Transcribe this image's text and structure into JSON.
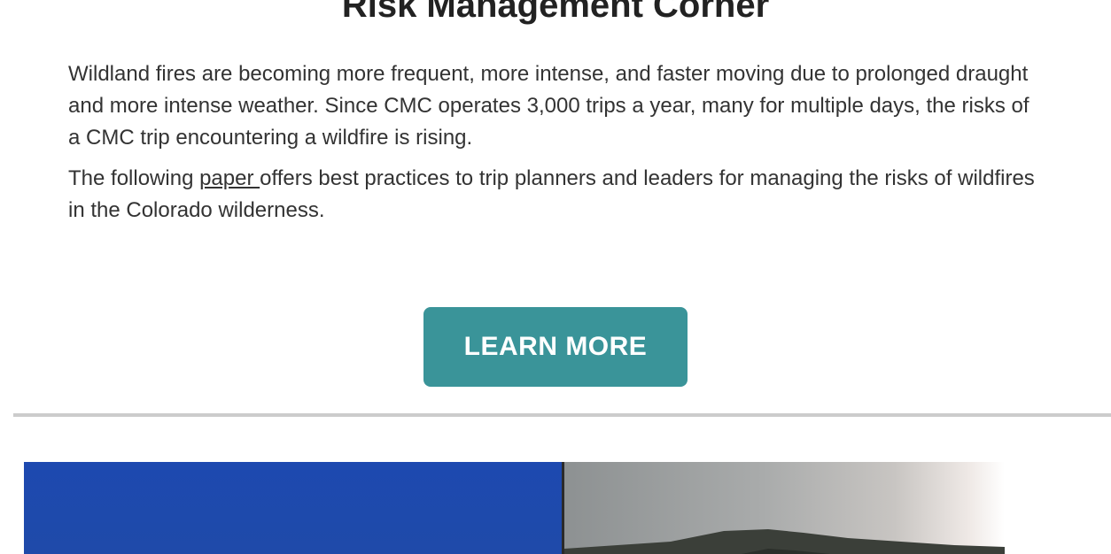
{
  "header": {
    "title": "Risk Management Corner"
  },
  "body": {
    "paragraph1": "Wildland fires are becoming more frequent, more intense, and faster moving due to prolonged draught and more intense weather. Since CMC operates 3,000 trips a year, many for multiple days, the risks of a CMC trip encountering a wildfire is rising.",
    "paragraph2_before": "The following ",
    "paragraph2_link": "paper ",
    "paragraph2_after": "offers best practices to trip planners and leaders for managing the risks of wildfires in the Colorado wilderness."
  },
  "cta": {
    "label": "LEARN MORE",
    "color": "#3a9499"
  },
  "colors": {
    "divider": "#cccccc",
    "text": "#333333"
  }
}
